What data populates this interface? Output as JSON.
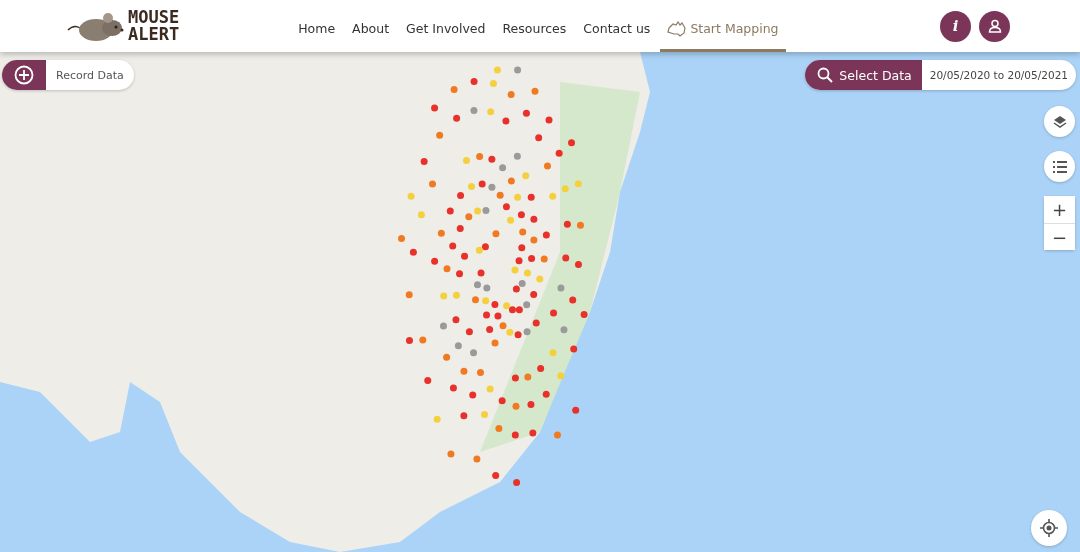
{
  "logo": {
    "line_1": "MOUSE",
    "line_2": "ALERT"
  },
  "nav": [
    {
      "label": "Home",
      "selected": false,
      "kind": "link"
    },
    {
      "label": "About",
      "selected": false,
      "kind": "link"
    },
    {
      "label": "Get Involved",
      "selected": false,
      "kind": "link"
    },
    {
      "label": "Resources",
      "selected": false,
      "kind": "link"
    },
    {
      "label": "Contact us",
      "selected": false,
      "kind": "link"
    },
    {
      "label": "Start Mapping",
      "selected": true,
      "kind": "mapping"
    }
  ],
  "header_buttons": {
    "info": "i"
  },
  "record_data": {
    "label": "Record Data"
  },
  "select_data": {
    "label": "Select Data",
    "date_range": "20/05/2020 to 20/05/2021"
  },
  "zoom": {
    "in": "+",
    "out": "−"
  }
}
